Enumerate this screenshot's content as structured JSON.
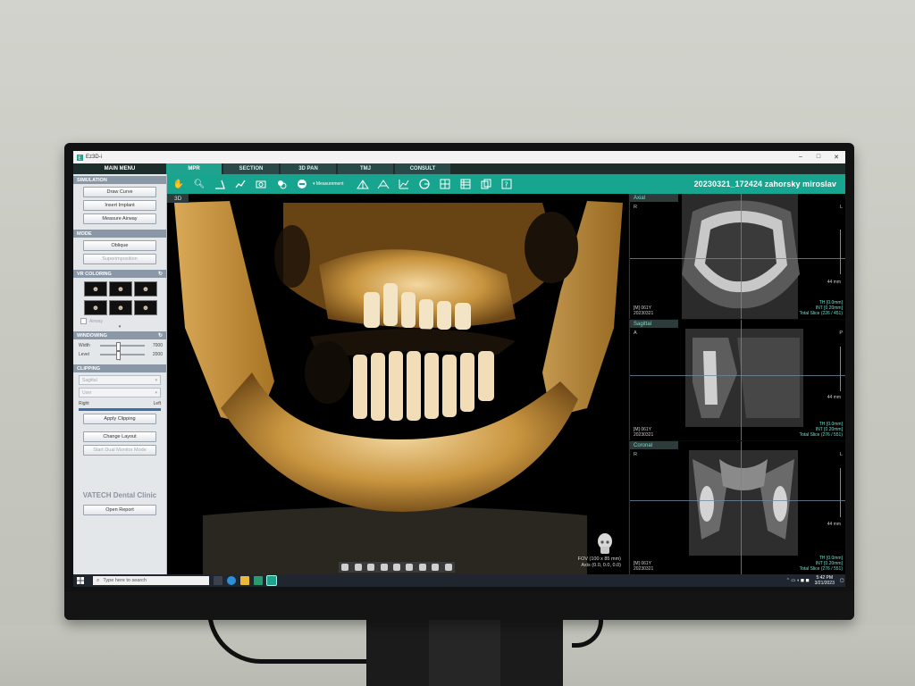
{
  "window": {
    "title": "Ez3D-i",
    "controls": [
      "–",
      "□",
      "✕"
    ]
  },
  "main_menu": {
    "label": "MAIN MENU"
  },
  "tabs": [
    {
      "label": "MPR",
      "active": true
    },
    {
      "label": "SECTION",
      "active": false
    },
    {
      "label": "3D PAN",
      "active": false
    },
    {
      "label": "TMJ",
      "active": false
    },
    {
      "label": "CONSULT",
      "active": false
    }
  ],
  "toolbar": {
    "measurement_label": "Measurement",
    "patient": "20230321_172424 zahorsky miroslav",
    "icons": [
      "hand-icon",
      "magnify-icon",
      "angle-icon",
      "polyline-icon",
      "camera-icon",
      "layers-icon",
      "measure-icon",
      "airway-icon",
      "airway2-icon",
      "chart-icon",
      "circle-icon",
      "grid-icon",
      "table-icon",
      "copy-icon",
      "help-icon"
    ]
  },
  "left_panel": {
    "simulation": {
      "header": "SIMULATION",
      "buttons": [
        "Draw Curve",
        "Insert Implant",
        "Measure Airway"
      ]
    },
    "mode": {
      "header": "MODE",
      "buttons": [
        "Oblique",
        "Superimposition"
      ]
    },
    "vr_coloring": {
      "header": "VR COLORING",
      "airway_label": "Airway"
    },
    "windowing": {
      "header": "WINDOWING",
      "width_label": "Width",
      "width_value": "7000",
      "width_level": 0.35,
      "level_label": "Level",
      "level_value": "2000",
      "level_level": 0.35
    },
    "clipping": {
      "header": "CLIPPING",
      "orientation": "Sagittal",
      "user": "User",
      "right_label": "Right",
      "left_label": "Left",
      "apply_button": "Apply Clipping"
    },
    "change_layout_button": "Change Layout",
    "start_dual_monitor_button": "Start Dual Monitor Mode",
    "clinic_name": "VATECH Dental Clinic",
    "open_report_button": "Open Report"
  },
  "view3d": {
    "tag": "3D",
    "fov_line1": "FOV (100 x 85 mm)",
    "fov_line2": "Axis (0.0, 0.0, 0.0)"
  },
  "mpr_panels": [
    {
      "tag": "Axial",
      "orient_left": "R",
      "orient_right": "L",
      "scale_mm": "44 mm",
      "info_left": [
        "[M] 061Y",
        "20230321"
      ],
      "info_right": [
        "TH [0.0mm]",
        "INT [0.20mm]",
        "Total Slice (226 / 451)"
      ]
    },
    {
      "tag": "Sagittal",
      "orient_left": "A",
      "orient_right": "P",
      "scale_mm": "44 mm",
      "info_left": [
        "[M] 061Y",
        "20230321"
      ],
      "info_right": [
        "TH [0.0mm]",
        "INT [0.20mm]",
        "Total Slice (276 / 551)"
      ]
    },
    {
      "tag": "Coronal",
      "orient_left": "R",
      "orient_right": "L",
      "scale_mm": "44 mm",
      "info_left": [
        "[M] 061Y",
        "20230321"
      ],
      "info_right": [
        "TH [0.0mm]",
        "INT [0.20mm]",
        "Total Slice (276 / 551)"
      ]
    }
  ],
  "taskbar": {
    "search_placeholder": "Type here to search",
    "time": "5:42 PM",
    "date": "3/21/2023"
  },
  "colors": {
    "accent": "#18a58f",
    "tab_active": "#1fa38f",
    "panel_header": "#8a97a6",
    "mpr_tag_text": "#6fe0d0"
  }
}
